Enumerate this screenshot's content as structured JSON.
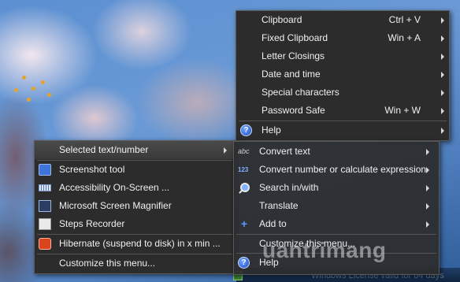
{
  "main_menu": {
    "items": [
      {
        "label": "Clipboard",
        "shortcut": "Ctrl + V",
        "icon": "",
        "submenu": true
      },
      {
        "label": "Fixed Clipboard",
        "shortcut": "Win + A",
        "icon": "",
        "submenu": true
      },
      {
        "label": "Letter Closings",
        "shortcut": "",
        "icon": "",
        "submenu": true
      },
      {
        "label": "Date and time",
        "shortcut": "",
        "icon": "",
        "submenu": true
      },
      {
        "label": "Special characters",
        "shortcut": "",
        "icon": "",
        "submenu": true
      },
      {
        "label": "Password Safe",
        "shortcut": "Win + W",
        "icon": "",
        "submenu": true
      },
      {
        "label": "Help",
        "shortcut": "",
        "icon": "help-icon",
        "submenu": true
      }
    ]
  },
  "left_menu": {
    "items": [
      {
        "label": "Selected text/number",
        "icon": "",
        "submenu": true,
        "highlighted": true
      },
      {
        "label": "Screenshot tool",
        "icon": "camera-icon"
      },
      {
        "label": "Accessibility On-Screen ...",
        "icon": "keyboard-icon"
      },
      {
        "label": "Microsoft Screen Magnifier",
        "icon": "magnifier-icon"
      },
      {
        "label": "Steps Recorder",
        "icon": "steps-recorder-icon"
      },
      {
        "label": "Hibernate (suspend to disk) in x min ...",
        "icon": "power-icon"
      },
      {
        "label": "Customize this menu...",
        "icon": ""
      }
    ]
  },
  "sub_menu": {
    "items": [
      {
        "label": "Convert text",
        "icon": "convert-text-icon",
        "icon_glyph": "abc",
        "submenu": true
      },
      {
        "label": "Convert number or calculate expression",
        "icon": "convert-number-icon",
        "icon_glyph": "123",
        "submenu": true
      },
      {
        "label": "Search in/with",
        "icon": "search-icon",
        "submenu": true
      },
      {
        "label": "Translate",
        "icon": "",
        "submenu": true
      },
      {
        "label": "Add to",
        "icon": "add-icon",
        "icon_glyph": "+",
        "submenu": true
      },
      {
        "label": "Customize this menu...",
        "icon": ""
      },
      {
        "label": "Help",
        "icon": "help-icon",
        "icon_glyph": "?"
      }
    ]
  },
  "help_glyph": "?",
  "taskbar": {
    "status_text": "Windows License valid for 64 days"
  },
  "watermark": {
    "text": "uantrimang"
  },
  "colors": {
    "menu_bg": "#2c2c2c",
    "menu_text": "#f0f0f0",
    "highlight": "#4a4a4a",
    "accent": "#5d9cff"
  }
}
